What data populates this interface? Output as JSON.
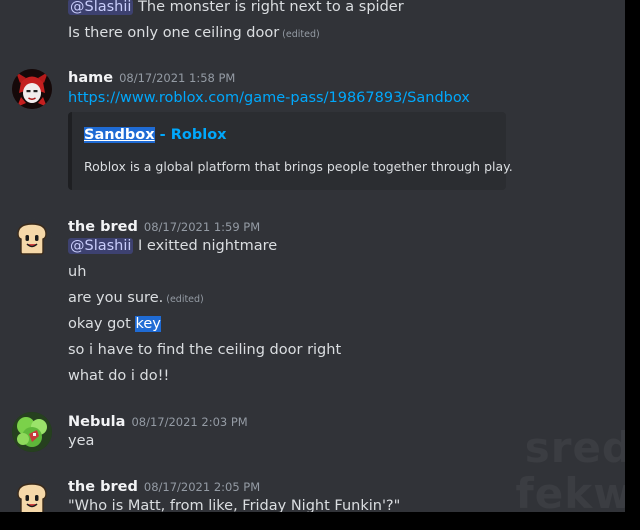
{
  "messages": {
    "m0": {
      "mention": "@Slashii",
      "text": " The monster is right next to a spider",
      "line2": "Is there only one ceiling door",
      "edited": "(edited)"
    },
    "m1": {
      "author": "hame",
      "timestamp": "08/17/2021 1:58 PM",
      "url": "https://www.roblox.com/game-pass/19867893/Sandbox",
      "embed": {
        "title_highlight": "Sandbox",
        "title_rest": " - Roblox",
        "description": "Roblox is a global platform that brings people together through play."
      }
    },
    "m2": {
      "author": "the bred",
      "timestamp": "08/17/2021 1:59 PM",
      "mention": "@Slashii",
      "line1_text": " I exitted nightmare",
      "line2": "uh",
      "line3": "are you sure.",
      "line3_edited": "(edited)",
      "line4_text": "okay got ",
      "line4_selected": "key",
      "line5": "so i have to find the ceiling door right",
      "line6": "what do i do!!"
    },
    "m3": {
      "author": "Nebula",
      "timestamp": "08/17/2021 2:03 PM",
      "line1": "yea"
    },
    "m4": {
      "author": "the bred",
      "timestamp": "08/17/2021 2:05 PM",
      "line1": "\"Who is Matt, from like, Friday Night Funkin'?\""
    }
  },
  "watermark": {
    "line1": "sred",
    "line2": "fekw"
  },
  "colors": {
    "background": "#313338",
    "link": "#00a8fc",
    "mention_bg": "#3c4270",
    "selection": "#1f6bd4"
  }
}
